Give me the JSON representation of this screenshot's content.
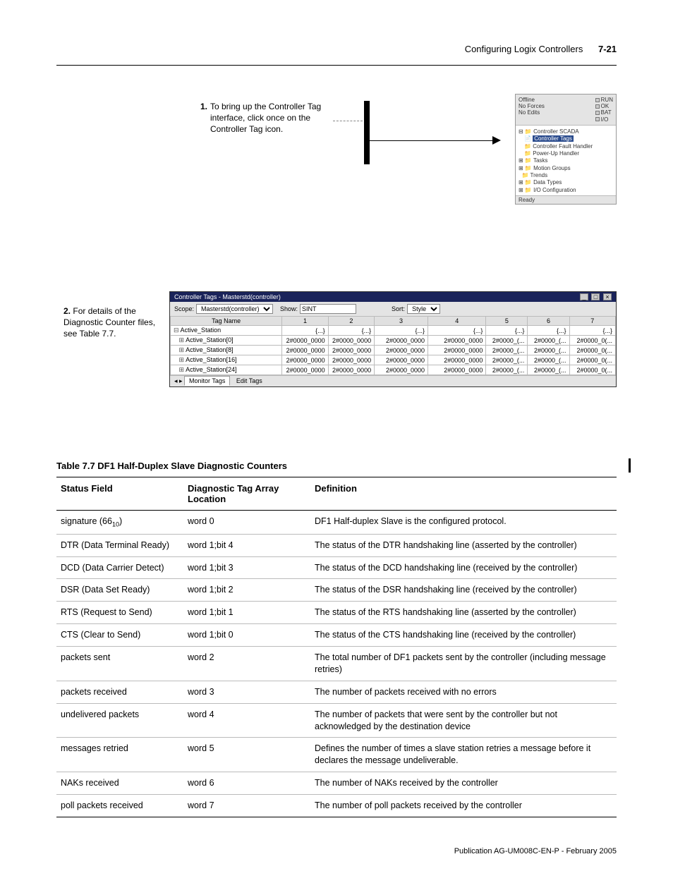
{
  "header": {
    "running_title": "Configuring Logix Controllers",
    "page_number": "7-21"
  },
  "step1": {
    "number": "1.",
    "text": "To bring up the Controller Tag interface, click once on the Controller Tag icon."
  },
  "mini_panel": {
    "offline": "Offline",
    "no_forces": "No Forces",
    "no_edits": "No Edits",
    "run": "RUN",
    "ok": "OK",
    "bat": "BAT",
    "io": "I/O",
    "tree": {
      "root": "Controller SCADA",
      "selected": "Controller Tags",
      "fault": "Controller Fault Handler",
      "powerup": "Power-Up Handler",
      "tasks": "Tasks",
      "motion": "Motion Groups",
      "trends": "Trends",
      "datatypes": "Data Types",
      "ioconfig": "I/O Configuration"
    },
    "status": "Ready"
  },
  "step2": {
    "number": "2.",
    "text": "For details of the Diagnostic Counter files, see Table 7.7."
  },
  "grid_window": {
    "title": "Controller Tags - Masterstd(controller)",
    "scope_label": "Scope:",
    "scope_value": "Masterstd(controller)",
    "show_label": "Show:",
    "show_value": "SINT",
    "sort_label": "Sort:",
    "sort_value": "Style",
    "headers": {
      "tag": "Tag Name",
      "c1": "1",
      "c2": "2",
      "c3": "3",
      "c4": "4",
      "c5": "5",
      "c6": "6",
      "c7": "7"
    },
    "rows": [
      {
        "name": "Active_Station",
        "v": [
          "{...}",
          "{...}",
          "{...}",
          "{...}",
          "{...}",
          "{...}",
          "{...}"
        ]
      },
      {
        "name": "Active_Station[0]",
        "v": [
          "2#0000_0000",
          "2#0000_0000",
          "2#0000_0000",
          "2#0000_0000",
          "2#0000_(...",
          "2#0000_(...",
          "2#0000_0(..."
        ]
      },
      {
        "name": "Active_Station[8]",
        "v": [
          "2#0000_0000",
          "2#0000_0000",
          "2#0000_0000",
          "2#0000_0000",
          "2#0000_(...",
          "2#0000_(...",
          "2#0000_0(..."
        ]
      },
      {
        "name": "Active_Station[16]",
        "v": [
          "2#0000_0000",
          "2#0000_0000",
          "2#0000_0000",
          "2#0000_0000",
          "2#0000_(...",
          "2#0000_(...",
          "2#0000_0(..."
        ]
      },
      {
        "name": "Active_Station[24]",
        "v": [
          "2#0000_0000",
          "2#0000_0000",
          "2#0000_0000",
          "2#0000_0000",
          "2#0000_(...",
          "2#0000_(...",
          "2#0000_0(..."
        ]
      }
    ],
    "tab_monitor": "Monitor Tags",
    "tab_edit": "Edit Tags"
  },
  "table77": {
    "caption": "Table 7.7  DF1 Half-Duplex Slave Diagnostic Counters",
    "headers": {
      "field": "Status Field",
      "loc": "Diagnostic Tag Array Location",
      "def": "Definition"
    },
    "rows": [
      {
        "field_html": "signature (66<sub>10</sub>)",
        "loc": "word 0",
        "def": "DF1 Half-duplex Slave is the configured protocol."
      },
      {
        "field": "DTR (Data Terminal Ready)",
        "loc": "word 1;bit 4",
        "def": "The status of the DTR handshaking line (asserted by the controller)"
      },
      {
        "field": "DCD (Data Carrier Detect)",
        "loc": "word 1;bit 3",
        "def": "The status of the DCD handshaking line (received by the controller)"
      },
      {
        "field": "DSR (Data Set Ready)",
        "loc": "word 1;bit 2",
        "def": "The status of the DSR handshaking line (received by the controller)"
      },
      {
        "field": "RTS (Request to Send)",
        "loc": "word 1;bit 1",
        "def": "The status of the RTS handshaking line (asserted by the controller)"
      },
      {
        "field": "CTS (Clear to Send)",
        "loc": "word 1;bit 0",
        "def": "The status of the CTS handshaking line (received by the controller)"
      },
      {
        "field": "packets sent",
        "loc": "word 2",
        "def": "The total number of DF1 packets sent by the controller (including message retries)"
      },
      {
        "field": "packets received",
        "loc": "word 3",
        "def": "The number of packets received with no errors"
      },
      {
        "field": "undelivered packets",
        "loc": "word 4",
        "def": "The number of packets that were sent by the controller but not acknowledged by the destination device"
      },
      {
        "field": "messages retried",
        "loc": "word 5",
        "def": "Defines the number of times a slave station retries a message before it declares the message undeliverable."
      },
      {
        "field": "NAKs received",
        "loc": "word 6",
        "def": "The number of NAKs received by the controller"
      },
      {
        "field": "poll packets received",
        "loc": "word 7",
        "def": "The number of poll packets received by the controller"
      }
    ]
  },
  "footer": "Publication AG-UM008C-EN-P - February 2005"
}
